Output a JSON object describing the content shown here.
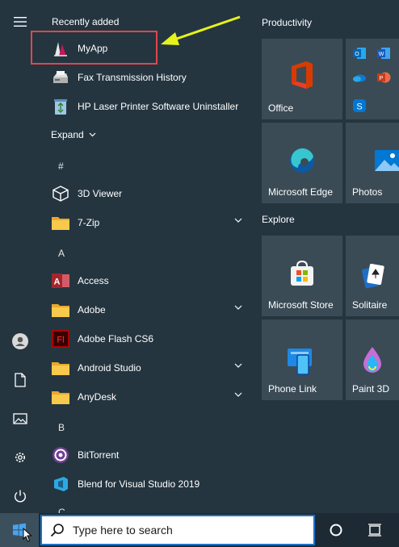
{
  "recently_added": {
    "title": "Recently added",
    "items": [
      {
        "label": "MyApp",
        "icon": "myapp-icon"
      },
      {
        "label": "Fax Transmission History",
        "icon": "fax-icon"
      },
      {
        "label": "HP Laser Printer Software Uninstaller",
        "icon": "recycle-icon"
      }
    ]
  },
  "expand_label": "Expand",
  "letters": {
    "hash": "#",
    "a": "A",
    "b": "B",
    "c": "C"
  },
  "apps": [
    {
      "label": "3D Viewer",
      "icon": "cube-icon",
      "folder": false
    },
    {
      "label": "7-Zip",
      "icon": "folder-icon",
      "folder": true
    },
    {
      "label": "Access",
      "icon": "access-icon",
      "folder": false
    },
    {
      "label": "Adobe",
      "icon": "folder-icon",
      "folder": true
    },
    {
      "label": "Adobe Flash CS6",
      "icon": "flash-icon",
      "folder": false
    },
    {
      "label": "Android Studio",
      "icon": "folder-icon",
      "folder": true
    },
    {
      "label": "AnyDesk",
      "icon": "folder-icon",
      "folder": true
    },
    {
      "label": "BitTorrent",
      "icon": "bittorrent-icon",
      "folder": false
    },
    {
      "label": "Blend for Visual Studio 2019",
      "icon": "blend-icon",
      "folder": false
    }
  ],
  "groups": {
    "productivity": "Productivity",
    "explore": "Explore"
  },
  "tiles": {
    "office": "Office",
    "edge": "Microsoft Edge",
    "photos": "Photos",
    "store": "Microsoft Store",
    "solitaire": "Solitaire",
    "phone_link": "Phone Link",
    "paint3d": "Paint 3D"
  },
  "search": {
    "placeholder": "Type here to search"
  },
  "colors": {
    "accent": "#1a73c8",
    "highlight_box": "#e0474c",
    "arrow": "#e6f21a"
  }
}
